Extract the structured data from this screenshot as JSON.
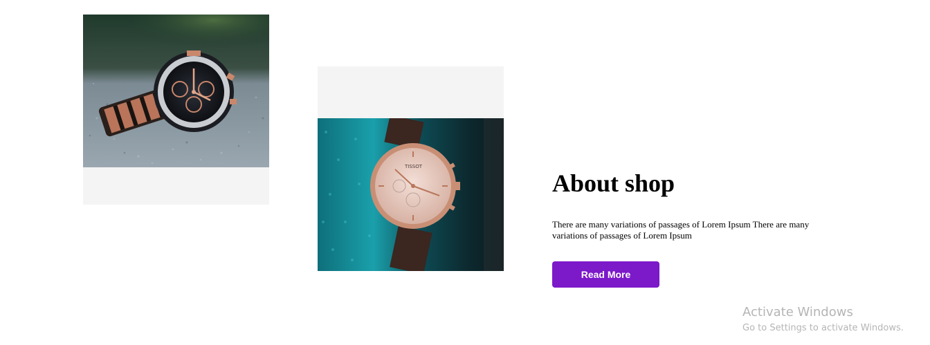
{
  "gallery": {
    "image_left": {
      "description": "wristwatch-photo",
      "icon": "watch-image-1"
    },
    "image_middle": {
      "description": "wristwatch-photo",
      "icon": "watch-image-2"
    }
  },
  "about": {
    "heading": "About shop",
    "body": "There are many variations of passages of Lorem Ipsum There are many variations of passages of Lorem Ipsum",
    "button_label": "Read More",
    "button_color": "#7c19c9"
  },
  "watermark": {
    "title": "Activate Windows",
    "subtitle": "Go to Settings to activate Windows."
  }
}
